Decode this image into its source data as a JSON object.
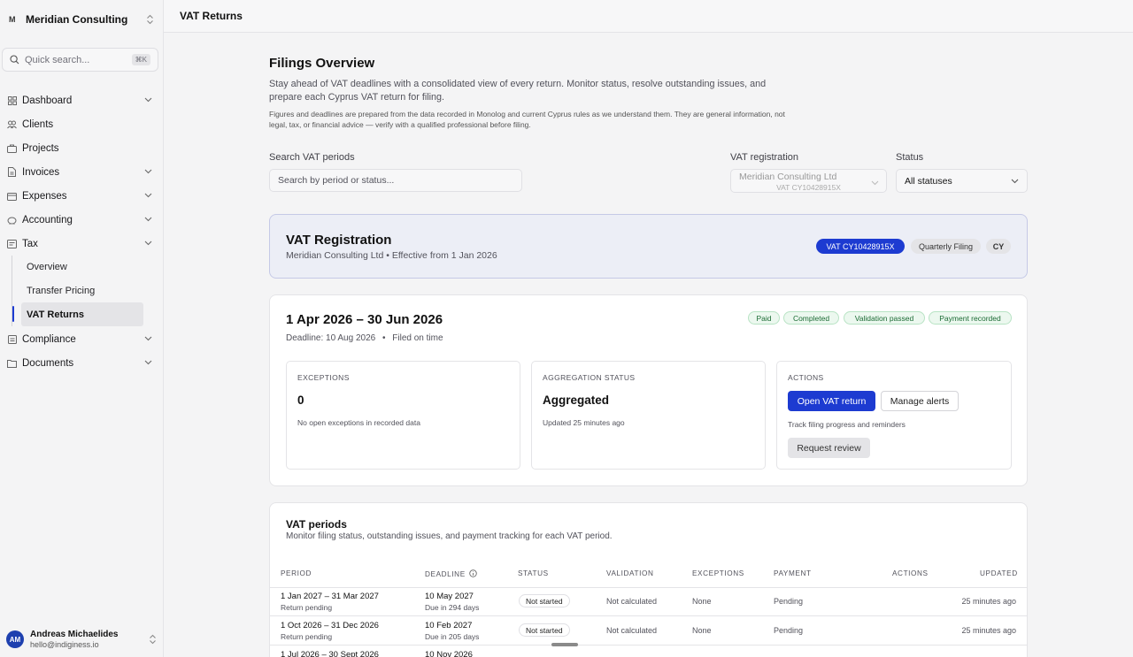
{
  "org": {
    "logo": "M",
    "name": "Meridian Consulting"
  },
  "search": {
    "label": "Quick search...",
    "shortcut": "⌘K"
  },
  "nav": {
    "dashboard": "Dashboard",
    "clients": "Clients",
    "projects": "Projects",
    "invoices": "Invoices",
    "expenses": "Expenses",
    "accounting": "Accounting",
    "tax": "Tax",
    "tax_sub": [
      "Overview",
      "Transfer Pricing",
      "VAT Returns"
    ],
    "compliance": "Compliance",
    "documents": "Documents"
  },
  "user": {
    "initials": "AM",
    "name": "Andreas Michaelides",
    "email": "hello@indiginess.io"
  },
  "topbar": {
    "title": "VAT Returns"
  },
  "overview": {
    "title": "Filings Overview",
    "description": "Stay ahead of VAT deadlines with a consolidated view of every return. Monitor status, resolve outstanding issues, and prepare each Cyprus VAT return for filing.",
    "disclaimer": "Figures and deadlines are prepared from the data recorded in Monolog and current Cyprus rules as we understand them. They are general information, not legal, tax, or financial advice — verify with a qualified professional before filing."
  },
  "filters": {
    "search_label": "Search VAT periods",
    "search_placeholder": "Search by period or status...",
    "vat_label": "VAT registration",
    "vat_value": "Meridian Consulting Ltd",
    "vat_number": "VAT CY10428915X",
    "status_label": "Status",
    "status_value": "All statuses"
  },
  "registration": {
    "title": "VAT Registration",
    "subtitle": "Meridian Consulting Ltd • Effective from 1 Jan 2026",
    "vat_badge": "VAT CY10428915X",
    "filing_badge": "Quarterly Filing",
    "country_badge": "CY"
  },
  "current_period": {
    "title": "1 Apr 2026 – 30 Jun 2026",
    "deadline": "Deadline: 10 Aug 2026",
    "filed": "Filed on time",
    "badges": [
      "Paid",
      "Completed",
      "Validation passed",
      "Payment recorded"
    ],
    "exceptions": {
      "heading": "EXCEPTIONS",
      "value": "0",
      "note": "No open exceptions in recorded data"
    },
    "aggregation": {
      "heading": "AGGREGATION STATUS",
      "value": "Aggregated",
      "note": "Updated 25 minutes ago"
    },
    "actions": {
      "heading": "ACTIONS",
      "open": "Open VAT return",
      "alerts": "Manage alerts",
      "note": "Track filing progress and reminders",
      "review": "Request review"
    }
  },
  "periods": {
    "title": "VAT periods",
    "subtitle": "Monitor filing status, outstanding issues, and payment tracking for each VAT period.",
    "columns": [
      "PERIOD",
      "DEADLINE",
      "STATUS",
      "VALIDATION",
      "EXCEPTIONS",
      "PAYMENT",
      "ACTIONS",
      "UPDATED"
    ],
    "rows": [
      {
        "period": "1 Jan 2027 – 31 Mar 2027",
        "period_note": "Return pending",
        "deadline": "10 May 2027",
        "deadline_note": "Due in 294 days",
        "status": "Not started",
        "validation": "Not calculated",
        "exceptions": "None",
        "payment": "Pending",
        "updated": "25 minutes ago"
      },
      {
        "period": "1 Oct 2026 – 31 Dec 2026",
        "period_note": "Return pending",
        "deadline": "10 Feb 2027",
        "deadline_note": "Due in 205 days",
        "status": "Not started",
        "validation": "Not calculated",
        "exceptions": "None",
        "payment": "Pending",
        "updated": "25 minutes ago"
      },
      {
        "period": "1 Jul 2026 – 30 Sept 2026",
        "deadline": "10 Nov 2026"
      }
    ]
  }
}
